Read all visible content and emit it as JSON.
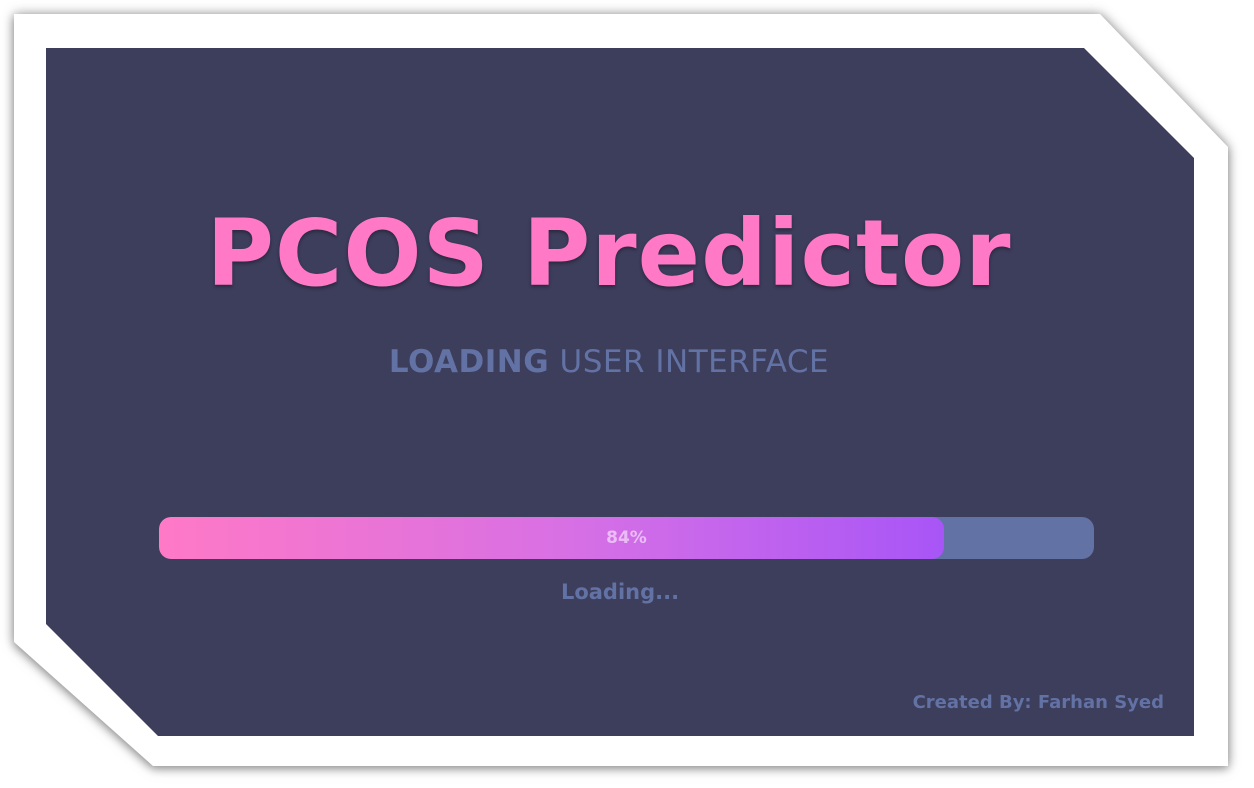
{
  "app": {
    "title": "PCOS Predictor",
    "subtitle_strong": "LOADING",
    "subtitle_rest": " USER INTERFACE"
  },
  "progress": {
    "label": "84%",
    "value_fraction": 0.84
  },
  "status": {
    "text": "Loading..."
  },
  "footer": {
    "credit": "Created By: Farhan Syed"
  },
  "colors": {
    "background": "#3d3d5c",
    "title": "#ff79c6",
    "muted": "#6272a4",
    "progress_start": "#ff79c6",
    "progress_end": "#a855f7"
  }
}
